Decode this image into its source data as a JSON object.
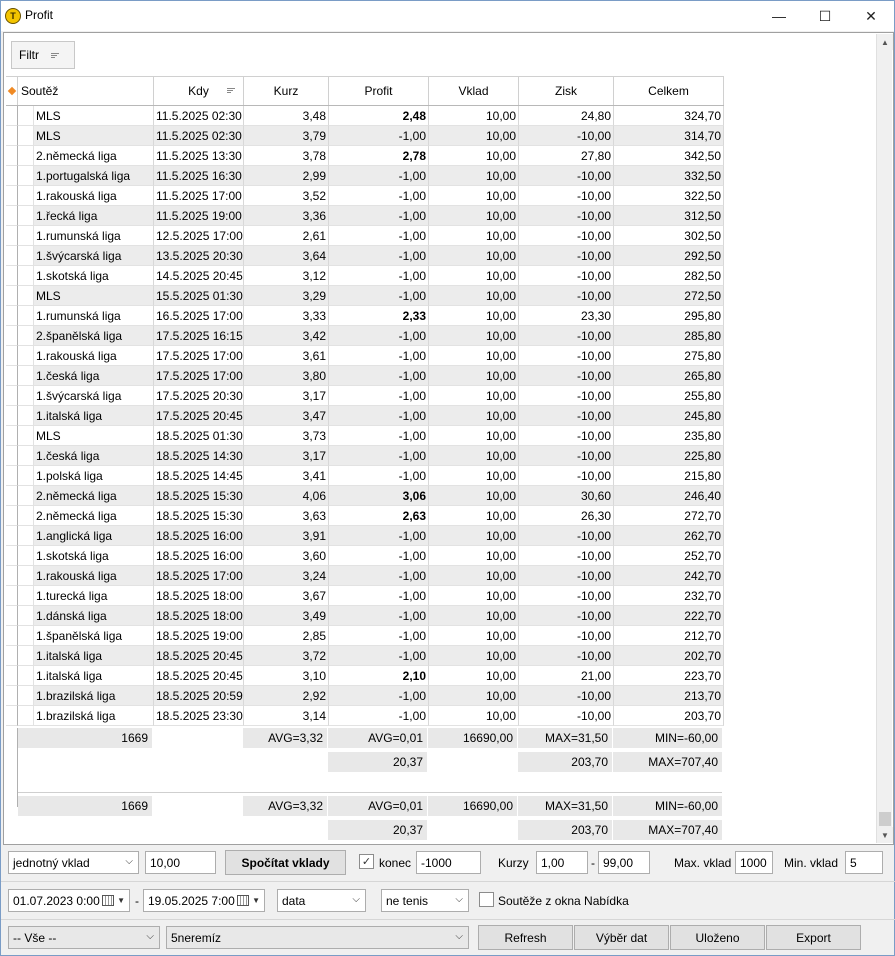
{
  "window": {
    "title": "Profit",
    "icon_name": "app-logo-icon",
    "minimize": "—",
    "maximize": "☐",
    "close": "✕"
  },
  "filter": {
    "label": "Filtr"
  },
  "columns": {
    "soutez": "Soutěž",
    "kdy": "Kdy",
    "kurz": "Kurz",
    "profit": "Profit",
    "vklad": "Vklad",
    "zisk": "Zisk",
    "celkem": "Celkem"
  },
  "rows": [
    {
      "soutez": "MLS",
      "kdy": "11.5.2025 02:30",
      "kurz": "3,48",
      "profit": "2,48",
      "win": true,
      "vklad": "10,00",
      "zisk": "24,80",
      "celkem": "324,70"
    },
    {
      "soutez": "MLS",
      "kdy": "11.5.2025 02:30",
      "kurz": "3,79",
      "profit": "-1,00",
      "win": false,
      "vklad": "10,00",
      "zisk": "-10,00",
      "celkem": "314,70"
    },
    {
      "soutez": "2.německá liga",
      "kdy": "11.5.2025 13:30",
      "kurz": "3,78",
      "profit": "2,78",
      "win": true,
      "vklad": "10,00",
      "zisk": "27,80",
      "celkem": "342,50"
    },
    {
      "soutez": "1.portugalská liga",
      "kdy": "11.5.2025 16:30",
      "kurz": "2,99",
      "profit": "-1,00",
      "win": false,
      "vklad": "10,00",
      "zisk": "-10,00",
      "celkem": "332,50"
    },
    {
      "soutez": "1.rakouská liga",
      "kdy": "11.5.2025 17:00",
      "kurz": "3,52",
      "profit": "-1,00",
      "win": false,
      "vklad": "10,00",
      "zisk": "-10,00",
      "celkem": "322,50"
    },
    {
      "soutez": "1.řecká liga",
      "kdy": "11.5.2025 19:00",
      "kurz": "3,36",
      "profit": "-1,00",
      "win": false,
      "vklad": "10,00",
      "zisk": "-10,00",
      "celkem": "312,50"
    },
    {
      "soutez": "1.rumunská liga",
      "kdy": "12.5.2025 17:00",
      "kurz": "2,61",
      "profit": "-1,00",
      "win": false,
      "vklad": "10,00",
      "zisk": "-10,00",
      "celkem": "302,50"
    },
    {
      "soutez": "1.švýcarská liga",
      "kdy": "13.5.2025 20:30",
      "kurz": "3,64",
      "profit": "-1,00",
      "win": false,
      "vklad": "10,00",
      "zisk": "-10,00",
      "celkem": "292,50"
    },
    {
      "soutez": "1.skotská liga",
      "kdy": "14.5.2025 20:45",
      "kurz": "3,12",
      "profit": "-1,00",
      "win": false,
      "vklad": "10,00",
      "zisk": "-10,00",
      "celkem": "282,50"
    },
    {
      "soutez": "MLS",
      "kdy": "15.5.2025 01:30",
      "kurz": "3,29",
      "profit": "-1,00",
      "win": false,
      "vklad": "10,00",
      "zisk": "-10,00",
      "celkem": "272,50"
    },
    {
      "soutez": "1.rumunská liga",
      "kdy": "16.5.2025 17:00",
      "kurz": "3,33",
      "profit": "2,33",
      "win": true,
      "vklad": "10,00",
      "zisk": "23,30",
      "celkem": "295,80"
    },
    {
      "soutez": "2.španělská liga",
      "kdy": "17.5.2025 16:15",
      "kurz": "3,42",
      "profit": "-1,00",
      "win": false,
      "vklad": "10,00",
      "zisk": "-10,00",
      "celkem": "285,80"
    },
    {
      "soutez": "1.rakouská liga",
      "kdy": "17.5.2025 17:00",
      "kurz": "3,61",
      "profit": "-1,00",
      "win": false,
      "vklad": "10,00",
      "zisk": "-10,00",
      "celkem": "275,80"
    },
    {
      "soutez": "1.česká liga",
      "kdy": "17.5.2025 17:00",
      "kurz": "3,80",
      "profit": "-1,00",
      "win": false,
      "vklad": "10,00",
      "zisk": "-10,00",
      "celkem": "265,80"
    },
    {
      "soutez": "1.švýcarská liga",
      "kdy": "17.5.2025 20:30",
      "kurz": "3,17",
      "profit": "-1,00",
      "win": false,
      "vklad": "10,00",
      "zisk": "-10,00",
      "celkem": "255,80"
    },
    {
      "soutez": "1.italská liga",
      "kdy": "17.5.2025 20:45",
      "kurz": "3,47",
      "profit": "-1,00",
      "win": false,
      "vklad": "10,00",
      "zisk": "-10,00",
      "celkem": "245,80"
    },
    {
      "soutez": "MLS",
      "kdy": "18.5.2025 01:30",
      "kurz": "3,73",
      "profit": "-1,00",
      "win": false,
      "vklad": "10,00",
      "zisk": "-10,00",
      "celkem": "235,80"
    },
    {
      "soutez": "1.česká liga",
      "kdy": "18.5.2025 14:30",
      "kurz": "3,17",
      "profit": "-1,00",
      "win": false,
      "vklad": "10,00",
      "zisk": "-10,00",
      "celkem": "225,80"
    },
    {
      "soutez": "1.polská liga",
      "kdy": "18.5.2025 14:45",
      "kurz": "3,41",
      "profit": "-1,00",
      "win": false,
      "vklad": "10,00",
      "zisk": "-10,00",
      "celkem": "215,80"
    },
    {
      "soutez": "2.německá liga",
      "kdy": "18.5.2025 15:30",
      "kurz": "4,06",
      "profit": "3,06",
      "win": true,
      "vklad": "10,00",
      "zisk": "30,60",
      "celkem": "246,40"
    },
    {
      "soutez": "2.německá liga",
      "kdy": "18.5.2025 15:30",
      "kurz": "3,63",
      "profit": "2,63",
      "win": true,
      "vklad": "10,00",
      "zisk": "26,30",
      "celkem": "272,70"
    },
    {
      "soutez": "1.anglická liga",
      "kdy": "18.5.2025 16:00",
      "kurz": "3,91",
      "profit": "-1,00",
      "win": false,
      "vklad": "10,00",
      "zisk": "-10,00",
      "celkem": "262,70"
    },
    {
      "soutez": "1.skotská liga",
      "kdy": "18.5.2025 16:00",
      "kurz": "3,60",
      "profit": "-1,00",
      "win": false,
      "vklad": "10,00",
      "zisk": "-10,00",
      "celkem": "252,70"
    },
    {
      "soutez": "1.rakouská liga",
      "kdy": "18.5.2025 17:00",
      "kurz": "3,24",
      "profit": "-1,00",
      "win": false,
      "vklad": "10,00",
      "zisk": "-10,00",
      "celkem": "242,70"
    },
    {
      "soutez": "1.turecká liga",
      "kdy": "18.5.2025 18:00",
      "kurz": "3,67",
      "profit": "-1,00",
      "win": false,
      "vklad": "10,00",
      "zisk": "-10,00",
      "celkem": "232,70"
    },
    {
      "soutez": "1.dánská liga",
      "kdy": "18.5.2025 18:00",
      "kurz": "3,49",
      "profit": "-1,00",
      "win": false,
      "vklad": "10,00",
      "zisk": "-10,00",
      "celkem": "222,70"
    },
    {
      "soutez": "1.španělská liga",
      "kdy": "18.5.2025 19:00",
      "kurz": "2,85",
      "profit": "-1,00",
      "win": false,
      "vklad": "10,00",
      "zisk": "-10,00",
      "celkem": "212,70"
    },
    {
      "soutez": "1.italská liga",
      "kdy": "18.5.2025 20:45",
      "kurz": "3,72",
      "profit": "-1,00",
      "win": false,
      "vklad": "10,00",
      "zisk": "-10,00",
      "celkem": "202,70"
    },
    {
      "soutez": "1.italská liga",
      "kdy": "18.5.2025 20:45",
      "kurz": "3,10",
      "profit": "2,10",
      "win": true,
      "vklad": "10,00",
      "zisk": "21,00",
      "celkem": "223,70"
    },
    {
      "soutez": "1.brazilská liga",
      "kdy": "18.5.2025 20:59",
      "kurz": "2,92",
      "profit": "-1,00",
      "win": false,
      "vklad": "10,00",
      "zisk": "-10,00",
      "celkem": "213,70"
    },
    {
      "soutez": "1.brazilská liga",
      "kdy": "18.5.2025 23:30",
      "kurz": "3,14",
      "profit": "-1,00",
      "win": false,
      "vklad": "10,00",
      "zisk": "-10,00",
      "celkem": "203,70"
    }
  ],
  "summary": {
    "count": "1669",
    "kurz_avg": "AVG=3,32",
    "profit_avg": "AVG=0,01",
    "vklad_sum": "16690,00",
    "zisk_max": "MAX=31,50",
    "celkem_min": "MIN=-60,00",
    "profit_sum": "20,37",
    "zisk_sum": "203,70",
    "celkem_max": "MAX=707,40"
  },
  "controls": {
    "vklad_type": "jednotný vklad",
    "vklad_value": "10,00",
    "spocitat": "Spočítat vklady",
    "konec_label": "konec",
    "konec_checked": "✓",
    "konec_value": "-1000",
    "kurzy_label": "Kurzy",
    "kurzy_from": "1,00",
    "kurzy_dash": "-",
    "kurzy_to": "99,00",
    "max_vklad_label": "Max. vklad",
    "max_vklad_value": "1000",
    "min_vklad_label": "Min. vklad",
    "min_vklad_value": "5",
    "date_from": "01.07.2023   0:00",
    "date_dash": "-",
    "date_to": "19.05.2025   7:00",
    "data_select": "data",
    "tenis_select": "ne tenis",
    "souteze_label": "Soutěže z okna Nabídka",
    "vse_select": "-- Vše --",
    "strategy_select": "5neremíz",
    "refresh": "Refresh",
    "vyber_dat": "Výběr dat",
    "ulozeno": "Uloženo",
    "export": "Export"
  }
}
